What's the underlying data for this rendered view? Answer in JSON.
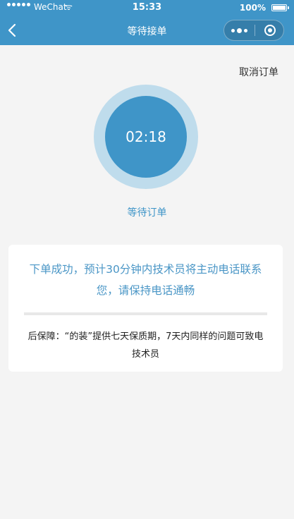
{
  "status_bar": {
    "carrier": "WeChat",
    "time": "15:33",
    "battery": "100%"
  },
  "nav": {
    "title": "等待接单",
    "back_icon": "chevron-left-icon",
    "more_icon": "more-dots-icon",
    "close_icon": "target-close-icon"
  },
  "cancel_label": "取消订单",
  "timer": {
    "value": "02:18",
    "caption": "等待订单"
  },
  "card": {
    "message": "下单成功，预计30分钟内技术员将主动电话联系您，请保持电话通畅",
    "note": "后保障：“的装”提供七天保质期，7天内同样的问题可致电技术员"
  },
  "colors": {
    "brand": "#3f95c8",
    "ring": "#bfdcec",
    "background": "#f4f4f4"
  }
}
